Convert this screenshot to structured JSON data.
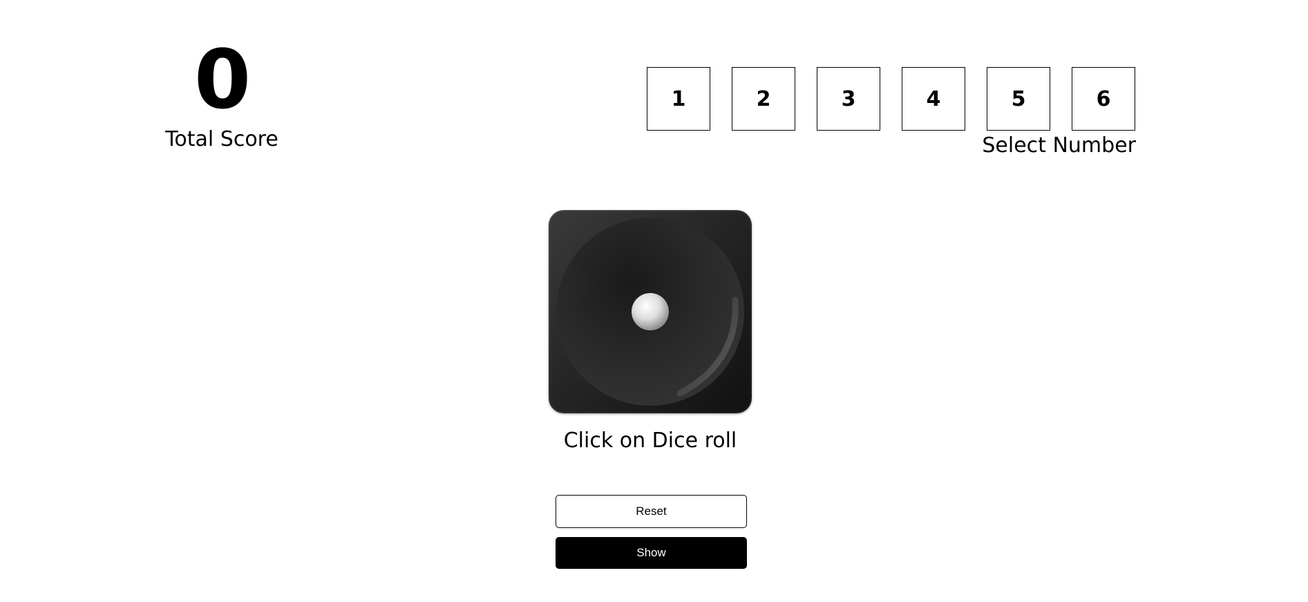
{
  "score": {
    "value": "0",
    "label": "Total Score"
  },
  "number_selector": {
    "options": [
      "1",
      "2",
      "3",
      "4",
      "5",
      "6"
    ],
    "label": "Select Number"
  },
  "dice": {
    "face_value": 1,
    "icon": "dice-one-icon",
    "instruction": "Click on Dice roll"
  },
  "buttons": {
    "reset_label": "Reset",
    "show_label": "Show"
  },
  "colors": {
    "primary": "#000000",
    "background": "#ffffff"
  }
}
